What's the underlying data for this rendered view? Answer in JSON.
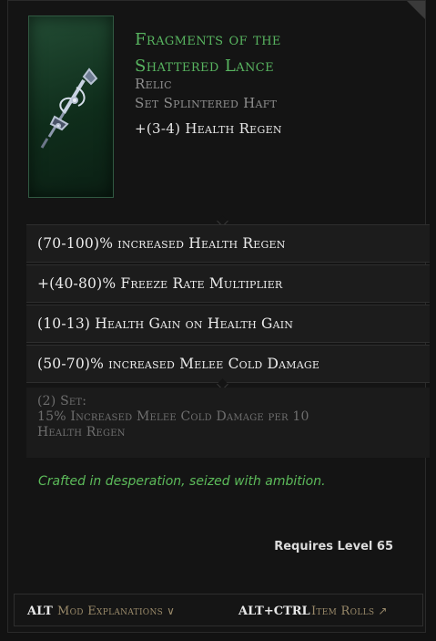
{
  "item": {
    "name_line1": "Fragments of the",
    "name_line2": "Shattered Lance",
    "type": "Relic",
    "base": "Set Splintered Haft",
    "implicit_value": "+(3-4)",
    "implicit_name": "Health Regen"
  },
  "affixes": [
    "(70-100)% increased Health Regen",
    "+(40-80)% Freeze Rate Multiplier",
    "(10-13) Health Gain on Health Gain",
    "(50-70)% increased Melee Cold Damage"
  ],
  "set_bonus": {
    "header": "(2) Set:",
    "text_line1": "15% Increased Melee Cold Damage per 10",
    "text_line2": "Health Regen"
  },
  "lore": "Crafted in desperation, seized with ambition.",
  "requirement": "Requires Level 65",
  "bottom_bar": {
    "key1": "ALT",
    "label1": "Mod Explanations",
    "icon1": "chevron-down-icon",
    "key2": "ALT+CTRL",
    "label2": "Item Rolls",
    "icon2": "arrow-up-right-icon"
  },
  "colors": {
    "item_name": "#58b560",
    "lore": "#5cbb5a",
    "card_green": "#1f4a30"
  }
}
